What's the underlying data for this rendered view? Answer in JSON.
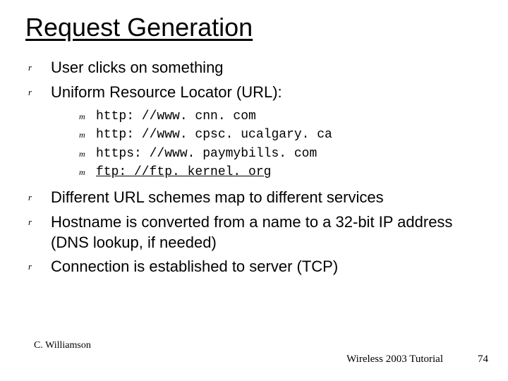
{
  "title": "Request Generation",
  "bullets": {
    "b1": "User clicks on something",
    "b2": "Uniform Resource Locator (URL):",
    "sub": {
      "s1": "http: //www. cnn. com",
      "s2": "http: //www. cpsc. ucalgary. ca",
      "s3": "https: //www. paymybills. com",
      "s4": "ftp: //ftp. kernel. org"
    },
    "b3": "Different URL schemes map to different services",
    "b4": "Hostname is converted from a name to a 32-bit IP address (DNS lookup, if needed)",
    "b5": "Connection is established to server (TCP)"
  },
  "footer": {
    "author": "C. Williamson",
    "event": "Wireless 2003 Tutorial",
    "page": "74"
  }
}
